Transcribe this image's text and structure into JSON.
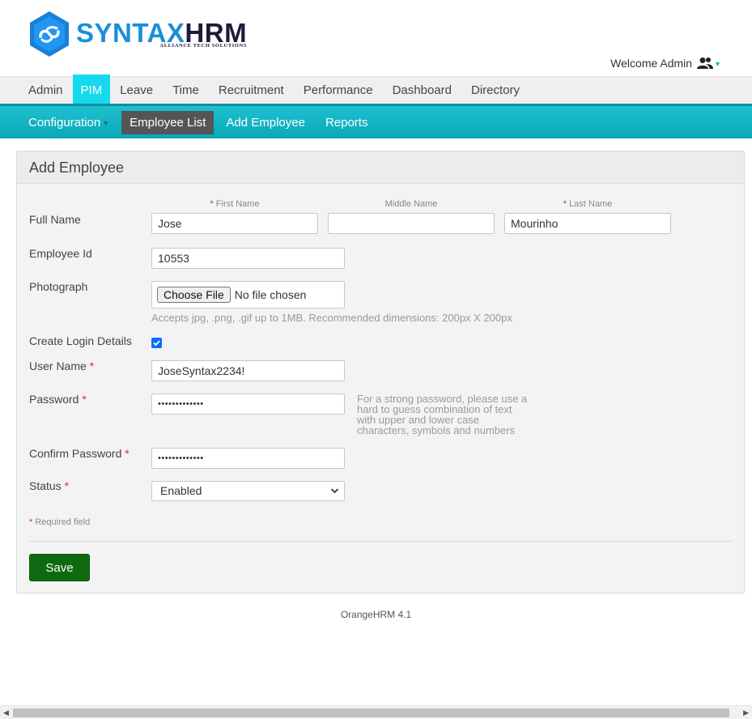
{
  "brand": {
    "name_part1": "SYNTAX",
    "name_part2": "HRM",
    "tagline": "ALLIANCE TECH SOLUTIONS"
  },
  "header": {
    "welcome": "Welcome Admin"
  },
  "main_nav": [
    "Admin",
    "PIM",
    "Leave",
    "Time",
    "Recruitment",
    "Performance",
    "Dashboard",
    "Directory"
  ],
  "main_nav_active": "PIM",
  "sub_nav": [
    "Configuration",
    "Employee List",
    "Add Employee",
    "Reports"
  ],
  "sub_nav_active": "Employee List",
  "form": {
    "title": "Add Employee",
    "full_name_label": "Full Name",
    "first_name_header": "First Name",
    "middle_name_header": "Middle Name",
    "last_name_header": "Last Name",
    "first_name": "Jose",
    "middle_name": "",
    "last_name": "Mourinho",
    "employee_id_label": "Employee Id",
    "employee_id": "10553",
    "photograph_label": "Photograph",
    "choose_file": "Choose File",
    "no_file": "No file chosen",
    "photo_hint": "Accepts jpg, .png, .gif up to 1MB. Recommended dimensions: 200px X 200px",
    "create_login_label": "Create Login Details",
    "create_login_checked": true,
    "username_label": "User Name",
    "username": "JoseSyntax2234!",
    "password_label": "Password",
    "password_mask": "•••••••••••••",
    "password_hint": "For a strong password, please use a hard to guess combination of text with upper and lower case characters, symbols and numbers",
    "confirm_password_label": "Confirm Password",
    "confirm_password_mask": "•••••••••••••",
    "status_label": "Status",
    "status_value": "Enabled",
    "required_note": "Required field",
    "save": "Save",
    "asterisk": "*"
  },
  "footer": {
    "version": "OrangeHRM 4.1"
  },
  "colors": {
    "accent": "#16d9ee",
    "subnav": "#0aa8b8",
    "save": "#0e6a11",
    "required": "#c0392b"
  }
}
